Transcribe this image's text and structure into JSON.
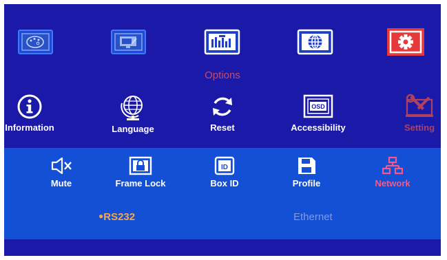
{
  "top_menu": {
    "items": [
      {
        "icon": "palette-icon"
      },
      {
        "icon": "display-settings-icon"
      },
      {
        "icon": "options-icon"
      },
      {
        "icon": "globe-icon"
      },
      {
        "icon": "gear-icon",
        "selected": true
      }
    ],
    "current_title": "Options"
  },
  "submenu": {
    "items": [
      {
        "label": "Information",
        "icon": "info-icon"
      },
      {
        "label": "Language",
        "icon": "globe-stand-icon"
      },
      {
        "label": "Reset",
        "icon": "reset-icon"
      },
      {
        "label": "Accessibility",
        "icon": "osd-icon"
      },
      {
        "label": "Setting",
        "icon": "setting-tools-icon",
        "selected": true
      }
    ]
  },
  "feature_row": {
    "items": [
      {
        "label": "Mute",
        "icon": "mute-icon"
      },
      {
        "label": "Frame Lock",
        "icon": "frame-lock-icon"
      },
      {
        "label": "Box ID",
        "icon": "box-id-icon"
      },
      {
        "label": "Profile",
        "icon": "save-icon"
      },
      {
        "label": "Network",
        "icon": "network-icon",
        "active": true
      }
    ]
  },
  "network_options": {
    "rs232": {
      "label": "RS232",
      "selected": true
    },
    "ethernet": {
      "label": "Ethernet",
      "selected": false
    }
  },
  "colors": {
    "background": "#1b1aa8",
    "band": "#1450d6",
    "highlight": "#e53a39",
    "active_text": "#f25a8a",
    "selected_option": "#f7a64b",
    "dim_option": "#7f9be3"
  }
}
